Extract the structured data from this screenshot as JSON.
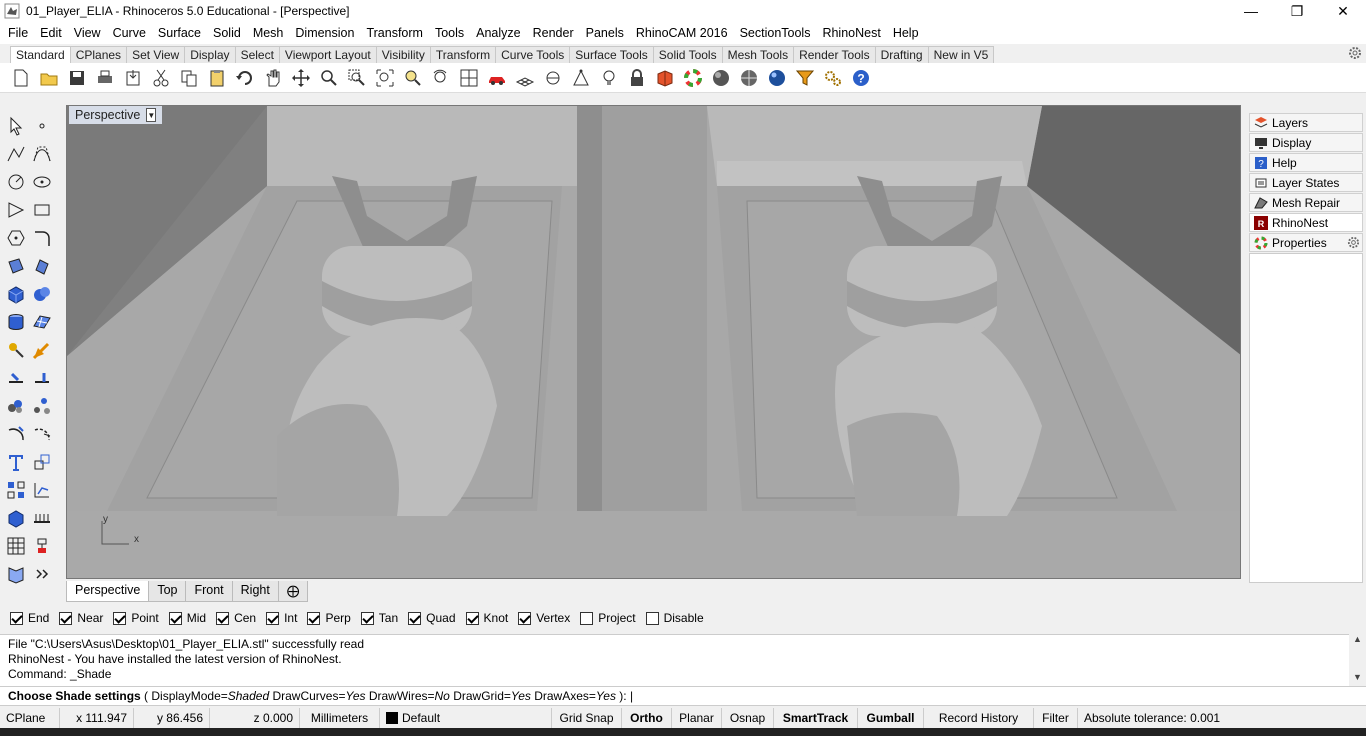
{
  "title": "01_Player_ELIA - Rhinoceros 5.0 Educational - [Perspective]",
  "menu": [
    "File",
    "Edit",
    "View",
    "Curve",
    "Surface",
    "Solid",
    "Mesh",
    "Dimension",
    "Transform",
    "Tools",
    "Analyze",
    "Render",
    "Panels",
    "RhinoCAM 2016",
    "SectionTools",
    "RhinoNest",
    "Help"
  ],
  "toolbar_tabs": [
    "Standard",
    "CPlanes",
    "Set View",
    "Display",
    "Select",
    "Viewport Layout",
    "Visibility",
    "Transform",
    "Curve Tools",
    "Surface Tools",
    "Solid Tools",
    "Mesh Tools",
    "Render Tools",
    "Drafting",
    "New in V5"
  ],
  "viewport": {
    "name": "Perspective",
    "axis_x": "x",
    "axis_y": "y"
  },
  "viewport_tabs": [
    "Perspective",
    "Top",
    "Front",
    "Right"
  ],
  "osnaps": [
    {
      "label": "End",
      "checked": true
    },
    {
      "label": "Near",
      "checked": true
    },
    {
      "label": "Point",
      "checked": true
    },
    {
      "label": "Mid",
      "checked": true
    },
    {
      "label": "Cen",
      "checked": true
    },
    {
      "label": "Int",
      "checked": true
    },
    {
      "label": "Perp",
      "checked": true
    },
    {
      "label": "Tan",
      "checked": true
    },
    {
      "label": "Quad",
      "checked": true
    },
    {
      "label": "Knot",
      "checked": true
    },
    {
      "label": "Vertex",
      "checked": true
    },
    {
      "label": "Project",
      "checked": false
    },
    {
      "label": "Disable",
      "checked": false
    }
  ],
  "command_history": [
    "File \"C:\\Users\\Asus\\Desktop\\01_Player_ELIA.stl\" successfully read",
    "RhinoNest - You have installed the latest version of RhinoNest.",
    "Command: _Shade"
  ],
  "prompt": {
    "title": "Choose Shade settings",
    "open": " ( ",
    "k1": "DisplayMode=",
    "v1": "Shaded",
    "k2": " DrawCurves=",
    "v2": "Yes",
    "k3": " DrawWires=",
    "v3": "No",
    "k4": " DrawGrid=",
    "v4": "Yes",
    "k5": " DrawAxes=",
    "v5": "Yes",
    "close": " ): "
  },
  "status": {
    "cplane": "CPlane",
    "x": "x 111.947",
    "y": "y 86.456",
    "z": "z 0.000",
    "units": "Millimeters",
    "layer": "Default",
    "grid_snap": "Grid Snap",
    "ortho": "Ortho",
    "planar": "Planar",
    "osnap": "Osnap",
    "smarttrack": "SmartTrack",
    "gumball": "Gumball",
    "record_history": "Record History",
    "filter": "Filter",
    "tolerance": "Absolute tolerance: 0.001"
  },
  "panels": [
    "Layers",
    "Display",
    "Help",
    "Layer States",
    "Mesh Repair",
    "RhinoNest",
    "Properties"
  ],
  "colors": {
    "accent_layer": "#000000",
    "viewport_bg": "#9a9a9a",
    "label_bg": "#d7dde8"
  }
}
